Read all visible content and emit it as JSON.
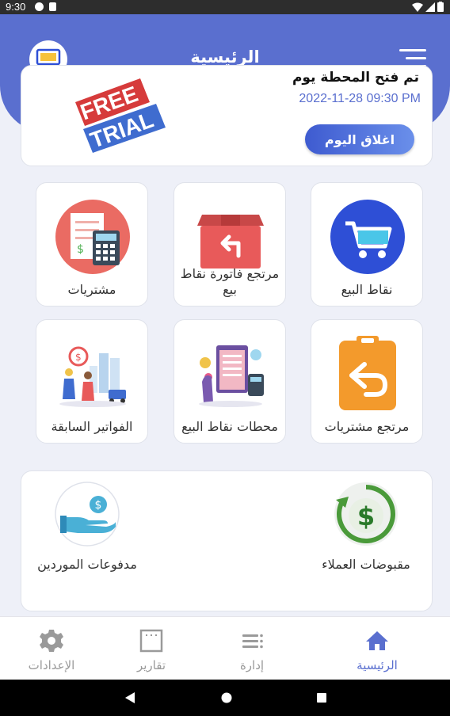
{
  "status_bar": {
    "time": "9:30"
  },
  "header": {
    "title": "الرئيسية"
  },
  "day_card": {
    "title": "تم فتح المحطة يوم",
    "datetime": "2022-11-28 09:30 PM",
    "close_button": "اغلاق اليوم",
    "badge": {
      "line1": "FREE",
      "line2": "TRIAL"
    }
  },
  "tiles": [
    {
      "label": "نقاط البيع",
      "icon": "cart-icon"
    },
    {
      "label": "مرتجع فاتورة نقاط بيع",
      "icon": "return-box-icon"
    },
    {
      "label": "مشتريات",
      "icon": "receipt-calculator-icon"
    },
    {
      "label": "مرتجع مشتريات",
      "icon": "return-clipboard-icon"
    },
    {
      "label": "محطات نقاط البيع",
      "icon": "pos-stations-icon"
    },
    {
      "label": "الفواتير السابقة",
      "icon": "previous-invoices-icon"
    }
  ],
  "bottom_card": {
    "customer_receipts": "مقبوضات العملاء",
    "supplier_payments": "مدفوعات الموردين"
  },
  "bottom_nav": [
    {
      "label": "الرئيسية",
      "icon": "home-icon",
      "active": true
    },
    {
      "label": "إدارة",
      "icon": "list-icon",
      "active": false
    },
    {
      "label": "تقارير",
      "icon": "report-icon",
      "active": false
    },
    {
      "label": "الإعدادات",
      "icon": "gear-icon",
      "active": false
    }
  ],
  "colors": {
    "primary": "#5a6fcf",
    "accent_red": "#e85a5a",
    "accent_orange": "#f39a2c",
    "accent_blue": "#2e4fd6"
  }
}
